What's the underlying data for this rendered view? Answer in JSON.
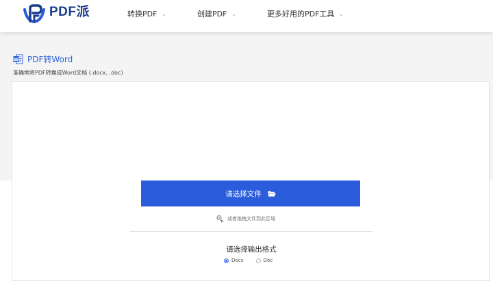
{
  "header": {
    "brand": "PDF派",
    "nav": [
      {
        "label": "转换PDF"
      },
      {
        "label": "创建PDF"
      },
      {
        "label": "更多好用的PDF工具"
      }
    ]
  },
  "page": {
    "title": "PDF转Word",
    "subtitle": "准确地将PDF转换成Word文档 (.docx, .doc)"
  },
  "upload": {
    "button_label": "请选择文件",
    "drag_hint": "或者拖拽文件到此区域"
  },
  "format": {
    "title": "请选择输出格式",
    "options": [
      {
        "label": "Docx",
        "selected": true
      },
      {
        "label": "Doc",
        "selected": false
      }
    ]
  },
  "colors": {
    "accent": "#2a5cdb",
    "brand": "#1a3e8c",
    "title": "#2f65d8",
    "background": "#f4f4f5"
  },
  "icons": {
    "logo": "pdfpai-logo-icon",
    "word": "word-doc-icon",
    "folder": "folder-open-icon",
    "drag": "drag-hand-icon",
    "chevron": "chevron-down-icon"
  }
}
